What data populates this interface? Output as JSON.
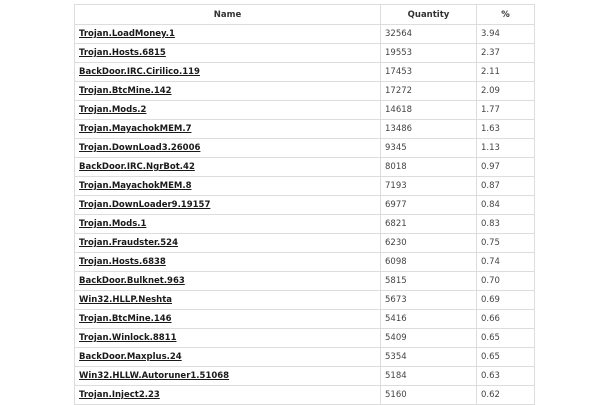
{
  "table": {
    "headers": {
      "name": "Name",
      "quantity": "Quantity",
      "percent": "%"
    },
    "rows": [
      {
        "name": "Trojan.LoadMoney.1",
        "quantity": "32564",
        "percent": "3.94"
      },
      {
        "name": "Trojan.Hosts.6815",
        "quantity": "19553",
        "percent": "2.37"
      },
      {
        "name": "BackDoor.IRC.Cirilico.119",
        "quantity": "17453",
        "percent": "2.11"
      },
      {
        "name": "Trojan.BtcMine.142",
        "quantity": "17272",
        "percent": "2.09"
      },
      {
        "name": "Trojan.Mods.2",
        "quantity": "14618",
        "percent": "1.77"
      },
      {
        "name": "Trojan.MayachokMEM.7",
        "quantity": "13486",
        "percent": "1.63"
      },
      {
        "name": "Trojan.DownLoad3.26006",
        "quantity": "9345",
        "percent": "1.13"
      },
      {
        "name": "BackDoor.IRC.NgrBot.42",
        "quantity": "8018",
        "percent": "0.97"
      },
      {
        "name": "Trojan.MayachokMEM.8",
        "quantity": "7193",
        "percent": "0.87"
      },
      {
        "name": "Trojan.DownLoader9.19157",
        "quantity": "6977",
        "percent": "0.84"
      },
      {
        "name": "Trojan.Mods.1",
        "quantity": "6821",
        "percent": "0.83"
      },
      {
        "name": "Trojan.Fraudster.524",
        "quantity": "6230",
        "percent": "0.75"
      },
      {
        "name": "Trojan.Hosts.6838",
        "quantity": "6098",
        "percent": "0.74"
      },
      {
        "name": "BackDoor.Bulknet.963",
        "quantity": "5815",
        "percent": "0.70"
      },
      {
        "name": "Win32.HLLP.Neshta",
        "quantity": "5673",
        "percent": "0.69"
      },
      {
        "name": "Trojan.BtcMine.146",
        "quantity": "5416",
        "percent": "0.66"
      },
      {
        "name": "Trojan.Winlock.8811",
        "quantity": "5409",
        "percent": "0.65"
      },
      {
        "name": "BackDoor.Maxplus.24",
        "quantity": "5354",
        "percent": "0.65"
      },
      {
        "name": "Win32.HLLW.Autoruner1.51068",
        "quantity": "5184",
        "percent": "0.63"
      },
      {
        "name": "Trojan.Inject2.23",
        "quantity": "5160",
        "percent": "0.62"
      }
    ]
  }
}
